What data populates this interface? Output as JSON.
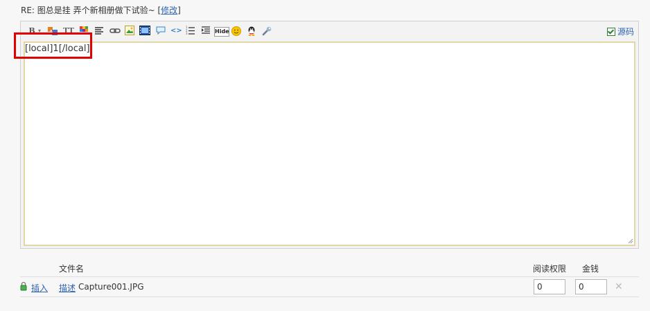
{
  "post": {
    "title_prefix": "RE: 图总是挂 弄个新相册做下试验~ [",
    "edit_link": "修改",
    "title_suffix": "]"
  },
  "editor": {
    "toolbar": [
      {
        "name": "bold-icon",
        "glyph": "B"
      },
      {
        "name": "font-color-icon",
        "glyph": "▾"
      },
      {
        "name": "font-family-icon",
        "glyph": "字"
      },
      {
        "name": "font-size-icon",
        "glyph": "TT"
      },
      {
        "name": "color-palette-icon",
        "glyph": ""
      },
      {
        "name": "align-icon",
        "glyph": ""
      },
      {
        "name": "link-icon",
        "glyph": ""
      },
      {
        "name": "image-icon",
        "glyph": ""
      },
      {
        "name": "media-icon",
        "glyph": ""
      },
      {
        "name": "quote-icon",
        "glyph": ""
      },
      {
        "name": "code-icon",
        "glyph": "<>"
      },
      {
        "name": "ordered-list-icon",
        "glyph": ""
      },
      {
        "name": "indent-icon",
        "glyph": ""
      },
      {
        "name": "hide-icon",
        "glyph": "Hide"
      },
      {
        "name": "smiley-icon",
        "glyph": ""
      },
      {
        "name": "qq-icon",
        "glyph": ""
      },
      {
        "name": "wrench-icon",
        "glyph": ""
      }
    ],
    "source_label": "源码",
    "source_checked": true,
    "content": "[local]1[/local]"
  },
  "attachments": {
    "header_filename": "文件名",
    "header_read_perm": "阅读权限",
    "header_price": "金钱",
    "rows": [
      {
        "insert_label": "插入",
        "describe_label": "描述",
        "filename": "Capture001.JPG",
        "read_perm": "0",
        "price": "0"
      }
    ]
  },
  "colors": {
    "link": "#2d64b3",
    "highlight": "#e00000",
    "textarea_border": "#e3d5a6"
  }
}
